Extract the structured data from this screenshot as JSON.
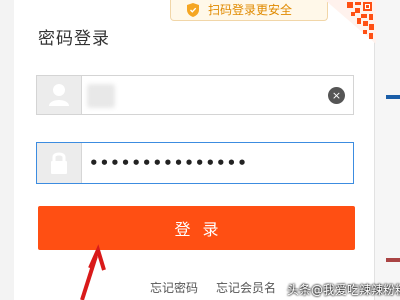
{
  "login": {
    "title": "密码登录",
    "qr_hint": "扫码登录更安全",
    "username": {
      "value": "",
      "clear_symbol": "×"
    },
    "password": {
      "value": "•••••••••••••••"
    },
    "submit_label": "登录",
    "links": {
      "forgot_password": "忘记密码",
      "forgot_username": "忘记会员名"
    }
  },
  "watermark": "头条@我爱吃辣辣粉粉",
  "colors": {
    "accent": "#ff4f13",
    "hint_text": "#e08a00",
    "focus_border": "#3c8ce0"
  }
}
